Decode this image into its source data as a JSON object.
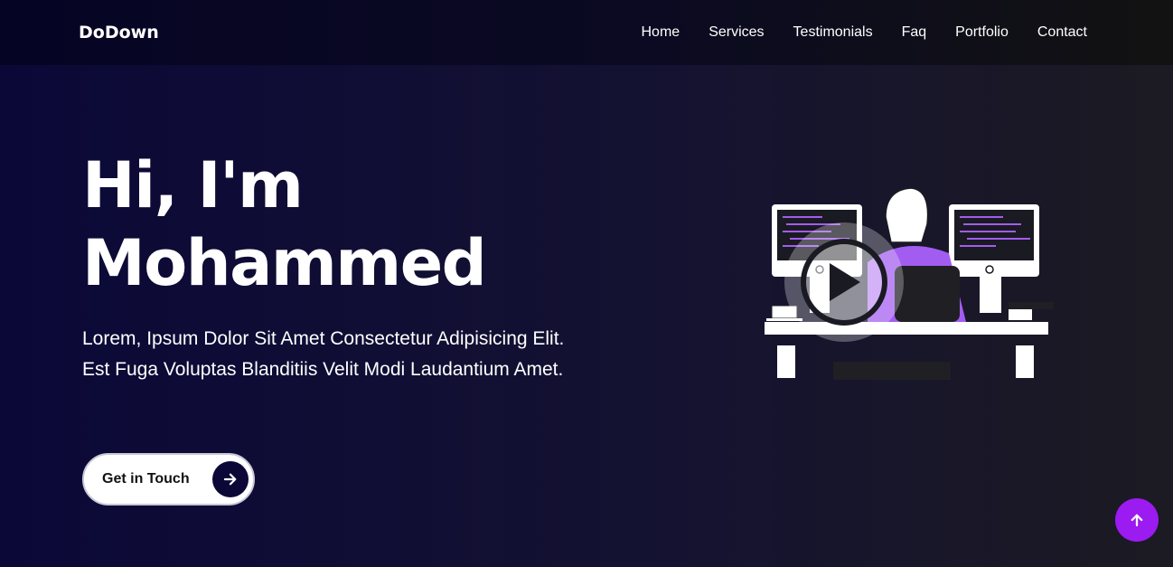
{
  "header": {
    "brand": "DoDown",
    "nav": [
      "Home",
      "Services",
      "Testimonials",
      "Faq",
      "Portfolio",
      "Contact"
    ]
  },
  "hero": {
    "title_line1": "Hi, I'm",
    "title_line2": "Mohammed",
    "description": "Lorem, Ipsum Dolor Sit Amet Consectetur Adipisicing Elit. Est Fuga Voluptas Blanditiis Velit Modi Laudantium Amet.",
    "cta_label": "Get in Touch"
  },
  "icons": {
    "cta": "arrow-right-icon",
    "play": "play-icon",
    "scroll": "arrow-up-icon"
  },
  "colors": {
    "accent": "#9b1bf0",
    "dark_navy": "#0b0838",
    "illustration_purple": "#a35cf0"
  }
}
